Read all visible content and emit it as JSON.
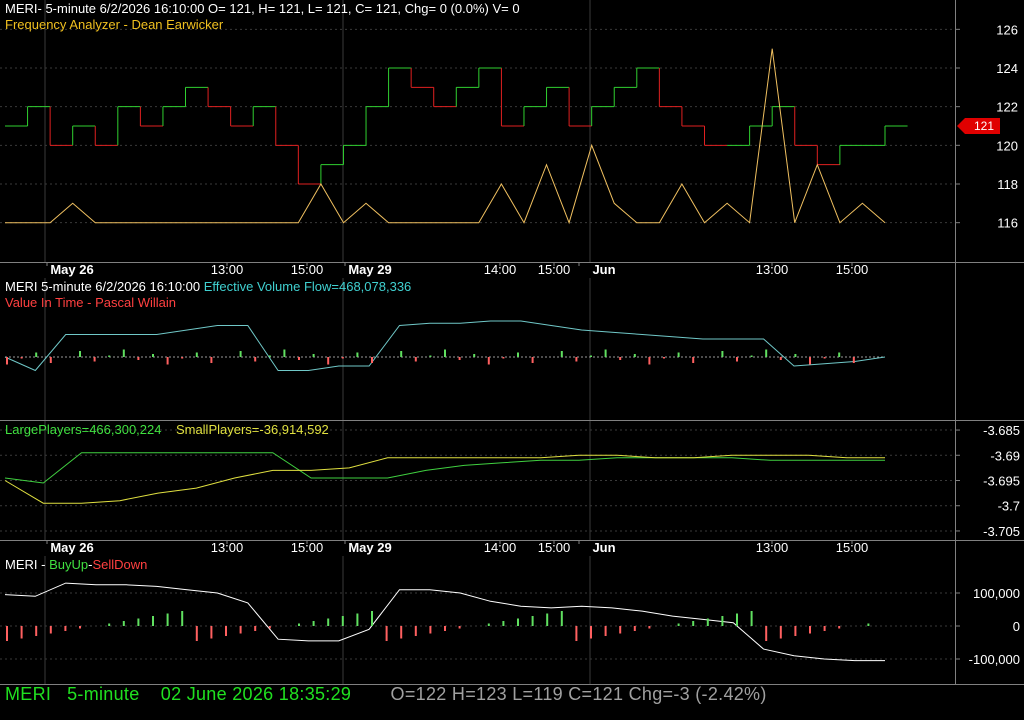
{
  "panel1": {
    "header_line1": "MERI- 5-minute 6/2/2026 16:10:00 O= 121, H= 121, L= 121, C= 121, Chg= 0 (0.0%) V= 0",
    "header_line2": "Frequency Analyzer - Dean Earwicker",
    "last_price_badge": "121"
  },
  "panel2": {
    "title": "MERI 5-minute  6/2/2026 16:10:00",
    "flow_label": "Effective Volume Flow=468,078,336",
    "subtitle": "Value In Time - Pascal Willain"
  },
  "panel3": {
    "large_label": "LargePlayers=466,300,224",
    "small_label": "SmallPlayers=-36,914,592"
  },
  "panel4": {
    "title_prefix": "MERI - ",
    "buy_label": "BuyUp",
    "sep": "-",
    "sell_label": "SellDown"
  },
  "status_bar": {
    "symbol": "MERI",
    "interval": "5-minute",
    "datetime": "02 June 2026 18:35:29",
    "ohlc": "O=122  H=123  L=119  C=121  Chg=-3 (-2.42%)"
  },
  "colors": {
    "background": "#000000",
    "grid": "#3a3a3a",
    "up_step": "#30d030",
    "down_step": "#e02020",
    "freq_line": "#f0c060",
    "flow_line": "#70c8c8",
    "large_line": "#40d040",
    "small_line": "#e0e040",
    "buyup_line": "#ffffff",
    "bar_up": "#60e060",
    "bar_down": "#ff6060",
    "badge": "#e00000"
  },
  "chart_data": [
    {
      "type": "line",
      "name": "price",
      "x_ticks": [
        "May 26",
        "13:00",
        "15:00",
        "May 29",
        "14:00",
        "15:00",
        "Jun",
        "13:00",
        "15:00"
      ],
      "y_ticks": [
        116,
        118,
        120,
        122,
        124,
        126
      ],
      "ylim": [
        115,
        127
      ],
      "series": [
        {
          "values": [
            121,
            122,
            120,
            121,
            120,
            122,
            121,
            122,
            123,
            122,
            121,
            122,
            120,
            118,
            119,
            120,
            122,
            124,
            123,
            122,
            123,
            124,
            121,
            122,
            123,
            121,
            122,
            123,
            124,
            122,
            121,
            120,
            120,
            121,
            122,
            120,
            119,
            120,
            120,
            121
          ]
        },
        {
          "values": [
            116,
            116,
            116,
            117,
            116,
            116,
            116,
            116,
            116,
            116,
            116,
            116,
            116,
            116,
            118,
            116,
            117,
            116,
            116,
            116,
            116,
            116,
            118,
            116,
            119,
            116,
            120,
            117,
            116,
            116,
            118,
            116,
            117,
            116,
            125,
            116,
            119,
            116,
            117,
            116
          ]
        }
      ]
    },
    {
      "type": "line",
      "name": "volume_flow",
      "series": [
        {
          "values": [
            0,
            -0.3,
            0.5,
            0.5,
            0.5,
            0.5,
            0.6,
            0.7,
            0.7,
            -0.3,
            -0.3,
            -0.2,
            -0.2,
            0.7,
            0.75,
            0.75,
            0.8,
            0.8,
            0.7,
            0.6,
            0.55,
            0.5,
            0.45,
            0.4,
            0.4,
            0.4,
            -0.2,
            -0.15,
            -0.1,
            0
          ]
        }
      ]
    },
    {
      "type": "line",
      "name": "players",
      "y_ticks": [
        -3.685,
        -3.69,
        -3.695,
        -3.7,
        -3.705
      ],
      "ylim": [
        -3.706,
        -3.684
      ],
      "series": [
        {
          "values": [
            -3.6945,
            -3.6955,
            -3.6895,
            -3.6895,
            -3.6895,
            -3.6895,
            -3.6895,
            -3.6895,
            -3.6945,
            -3.6945,
            -3.6945,
            -3.693,
            -3.692,
            -3.6915,
            -3.691,
            -3.691,
            -3.6905,
            -3.6905,
            -3.6905,
            -3.6905,
            -3.691,
            -3.691,
            -3.691,
            -3.691
          ]
        },
        {
          "values": [
            -3.695,
            -3.6995,
            -3.6995,
            -3.699,
            -3.6975,
            -3.6965,
            -3.6945,
            -3.693,
            -3.693,
            -3.6925,
            -3.6905,
            -3.6905,
            -3.6905,
            -3.6905,
            -3.6905,
            -3.69,
            -3.69,
            -3.6905,
            -3.6905,
            -3.69,
            -3.69,
            -3.69,
            -3.6905,
            -3.6905
          ]
        }
      ]
    },
    {
      "type": "line",
      "name": "buyup_selldown",
      "y_ticks": [
        100000,
        0,
        -100000
      ],
      "ylim": [
        -150000,
        150000
      ],
      "series": [
        {
          "values": [
            95000,
            90000,
            130000,
            125000,
            125000,
            120000,
            110000,
            100000,
            70000,
            -40000,
            -45000,
            -45000,
            -10000,
            110000,
            110000,
            100000,
            75000,
            60000,
            55000,
            60000,
            55000,
            45000,
            30000,
            20000,
            10000,
            -70000,
            -90000,
            -100000,
            -105000,
            -105000
          ]
        }
      ]
    }
  ]
}
